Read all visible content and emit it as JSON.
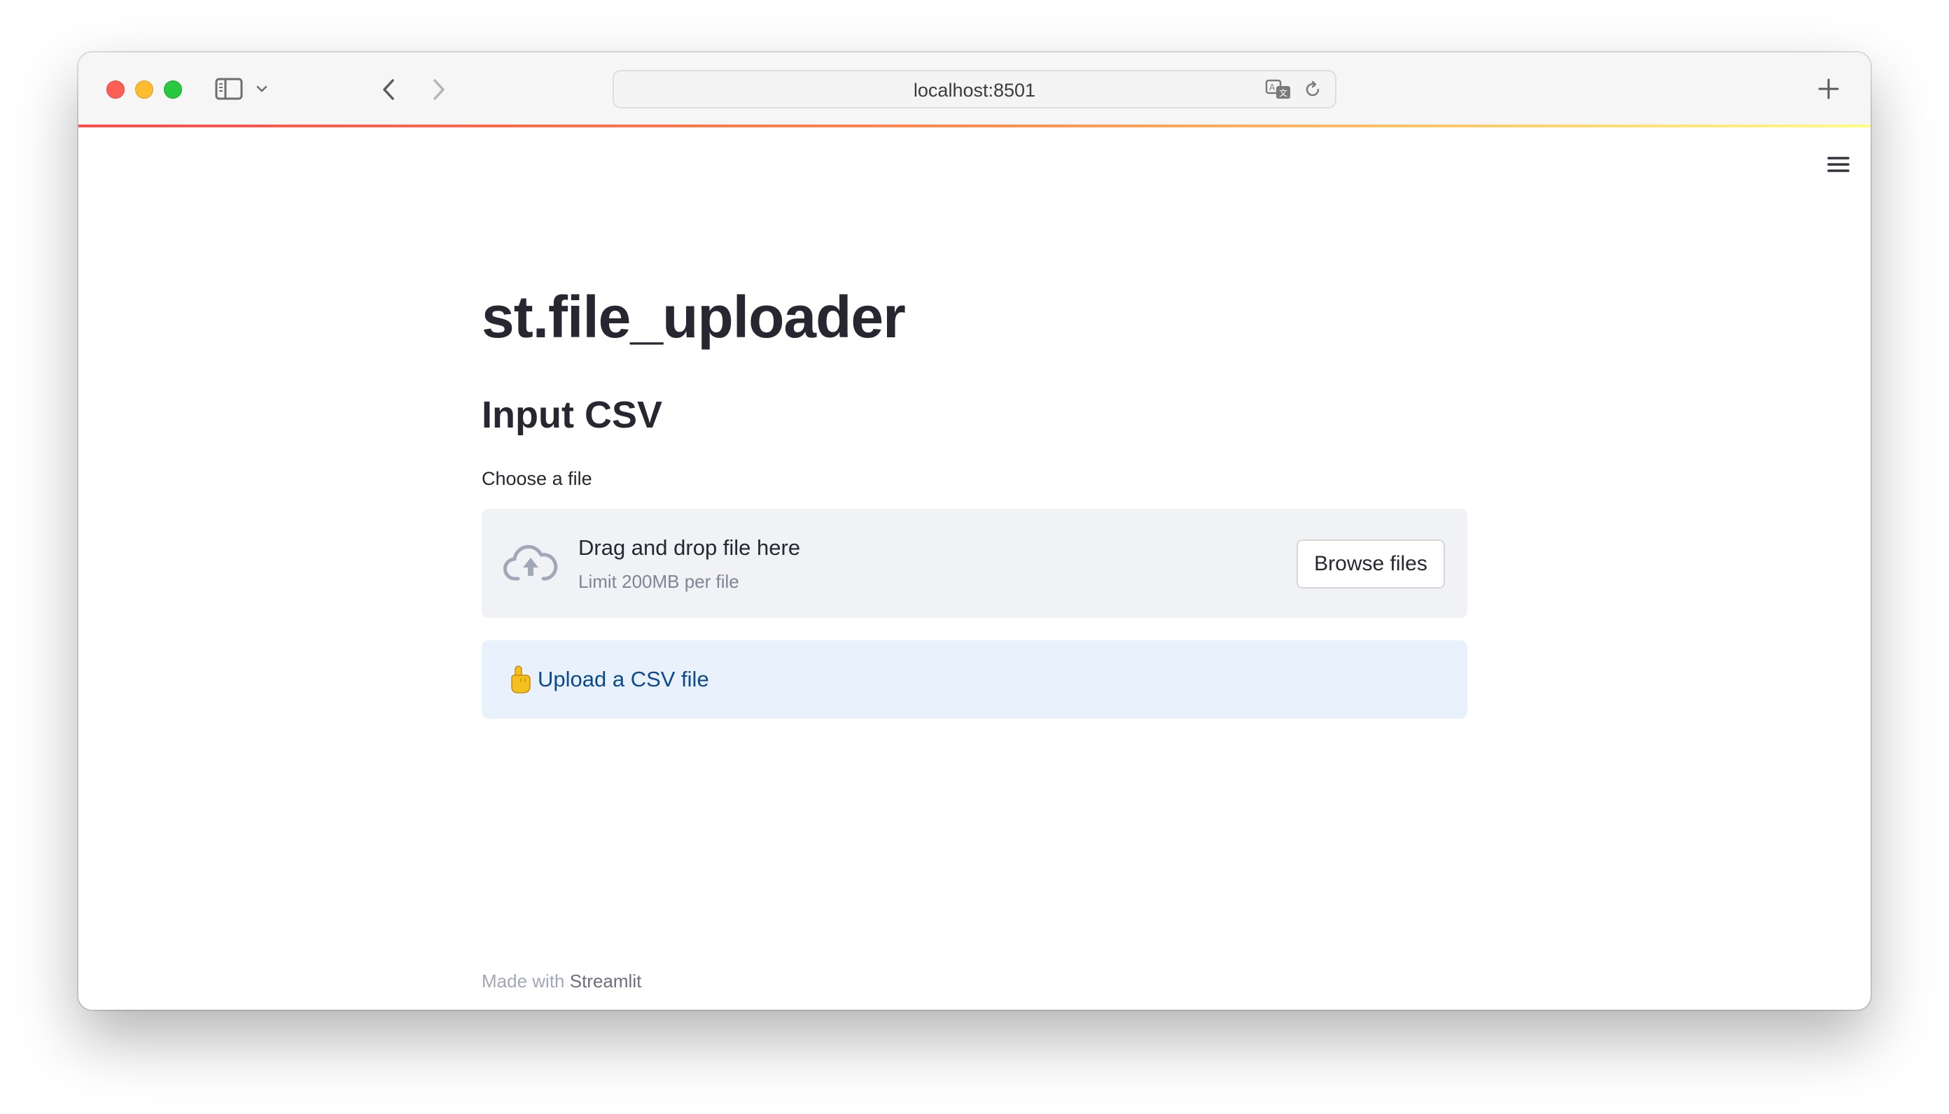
{
  "browser": {
    "url": "localhost:8501"
  },
  "app": {
    "title": "st.file_uploader",
    "subheader": "Input CSV",
    "uploader": {
      "label": "Choose a file",
      "drop_text": "Drag and drop file here",
      "limit_text": "Limit 200MB per file",
      "browse_label": "Browse files"
    },
    "info": {
      "emoji": "☝️",
      "text": "Upload a CSV file"
    },
    "footer": {
      "prefix": "Made with",
      "link": "Streamlit"
    }
  },
  "colors": {
    "accent_red": "#ff4b4b",
    "text_primary": "#262730",
    "dropzone_bg": "#f0f2f6",
    "info_bg": "#e8f1fc",
    "info_text": "#0b4a8f"
  },
  "icons": {
    "sidebar_toggle": "sidebar-icon",
    "back": "chevron-left-icon",
    "forward": "chevron-right-icon",
    "translate": "translate-icon",
    "reload": "reload-icon",
    "new_tab": "plus-icon",
    "menu": "hamburger-menu-icon",
    "upload": "cloud-upload-icon"
  }
}
